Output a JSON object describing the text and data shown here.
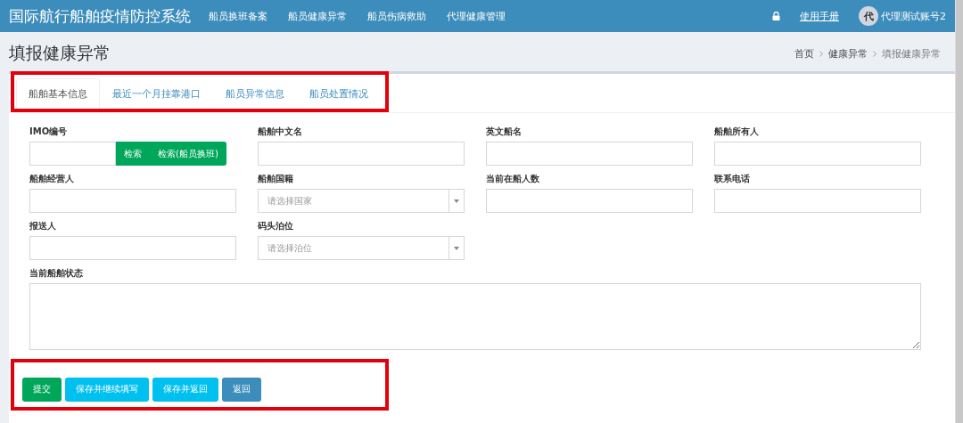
{
  "header": {
    "brand": "国际航行船舶疫情防控系统",
    "nav": [
      {
        "label": "船员换班备案"
      },
      {
        "label": "船员健康异常"
      },
      {
        "label": "船员伤病救助"
      },
      {
        "label": "代理健康管理"
      }
    ],
    "manual_link": "使用手册",
    "avatar": "代",
    "user": "代理测试账号2"
  },
  "page": {
    "title": "填报健康异常",
    "breadcrumb": [
      {
        "label": "首页",
        "current": false
      },
      {
        "label": "健康异常",
        "current": false
      },
      {
        "label": "填报健康异常",
        "current": true
      }
    ]
  },
  "tabs": {
    "highlighted": true,
    "items": [
      {
        "label": "船舶基本信息",
        "selected": true
      },
      {
        "label": "最近一个月挂靠港口",
        "selected": false
      },
      {
        "label": "船员异常信息",
        "selected": false
      },
      {
        "label": "船员处置情况",
        "selected": false
      }
    ]
  },
  "fields": [
    {
      "kind": "search",
      "label": "IMO编号",
      "buttons": [
        "检索",
        "检索(船员换班)"
      ]
    },
    {
      "kind": "text",
      "label": "船舶中文名"
    },
    {
      "kind": "text",
      "label": "英文船名"
    },
    {
      "kind": "text",
      "label": "船舶所有人"
    },
    {
      "kind": "text",
      "label": "船舶经营人"
    },
    {
      "kind": "select",
      "label": "船舶国籍",
      "placeholder": "请选择国家"
    },
    {
      "kind": "text",
      "label": "当前在船人数"
    },
    {
      "kind": "text",
      "label": "联系电话"
    },
    {
      "kind": "text",
      "label": "报送人"
    },
    {
      "kind": "select",
      "label": "码头泊位",
      "placeholder": "请选择泊位"
    },
    {
      "kind": "textarea",
      "label": "当前船舶状态"
    }
  ],
  "actions": {
    "highlighted": true,
    "buttons": [
      {
        "label": "提交",
        "kind": "success"
      },
      {
        "label": "保存并继续填写",
        "kind": "info"
      },
      {
        "label": "保存并返回",
        "kind": "info"
      },
      {
        "label": "返回",
        "kind": "primary"
      }
    ]
  }
}
